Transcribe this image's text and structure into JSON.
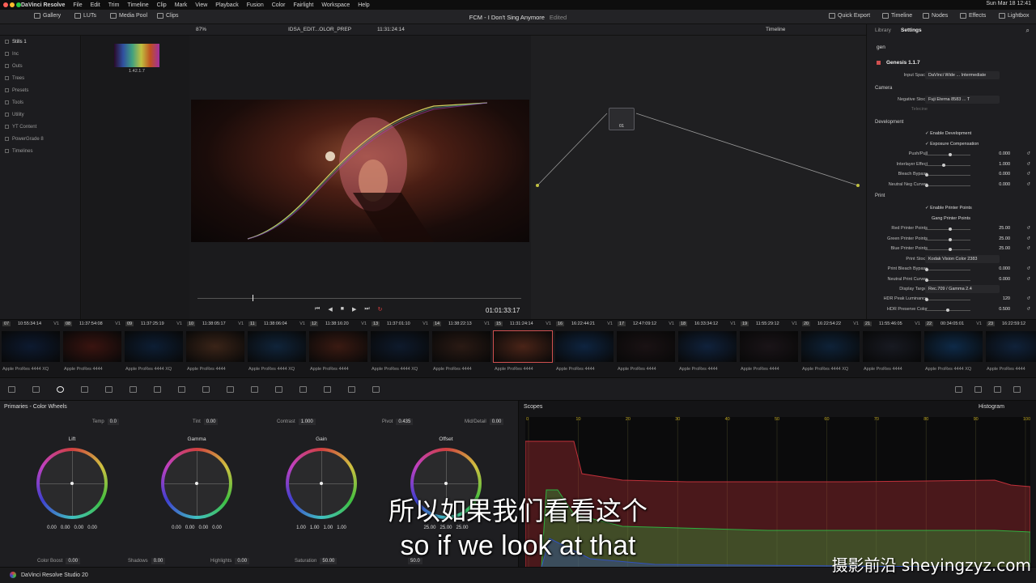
{
  "menubar": {
    "items": [
      "DaVinci Resolve",
      "File",
      "Edit",
      "Trim",
      "Timeline",
      "Clip",
      "Mark",
      "View",
      "Playback",
      "Fusion",
      "Color",
      "Fairlight",
      "Workspace",
      "Help"
    ],
    "clock": "Sun Mar 18 12:41"
  },
  "toolbar": {
    "gallery": "Gallery",
    "luts": "LUTs",
    "media_pool": "Media Pool",
    "clips": "Clips",
    "project_title": "FCM - I Don't Sing Anymore",
    "edited": "Edited",
    "quick_export": "Quick Export",
    "timeline": "Timeline",
    "nodes": "Nodes",
    "effects": "Effects",
    "lightbox": "Lightbox"
  },
  "subbar": {
    "zoom": "87%",
    "clip_name": "IDSA_EDIT...OLOR_PREP",
    "timecode": "11:31:24:14",
    "timeline_label": "Timeline",
    "library_tab": "Library",
    "settings_tab": "Settings"
  },
  "gallery": {
    "items": [
      "Stills 1",
      "Inc",
      "Outs",
      "Trees",
      "Presets",
      "Tools",
      "Utility",
      "YT Content",
      "PowerGrade 8",
      "Timelines"
    ],
    "still_label": "1.42.1.7"
  },
  "viewer": {
    "timecode": "01:01:33:17"
  },
  "nodes": {
    "node_label": "01"
  },
  "settings": {
    "search": "gen",
    "plugin": "Genesis 1.1.7",
    "input_space_label": "Input Space",
    "input_space": "DaVinci Wide ... Intermediate",
    "camera_header": "Camera",
    "negative_stock_label": "Negative Stock",
    "negative_stock": "Fuji Eterna 8583 ... T",
    "telecine_label": "Telecine",
    "development_header": "Development",
    "enable_development": "Enable Development",
    "exposure_compensation": "Exposure Compensation",
    "rows_dev": [
      {
        "label": "Push/Pull",
        "value": "0.000",
        "pos": 0.55
      },
      {
        "label": "Interlayer Effect",
        "value": "1.000",
        "pos": 0.4
      },
      {
        "label": "Bleach Bypass",
        "value": "0.000",
        "pos": 0.0
      },
      {
        "label": "Neutral Neg Curves",
        "value": "0.000",
        "pos": 0.0
      }
    ],
    "print_header": "Print",
    "enable_printer_points": "Enable Printer Points",
    "gang_printer_points": "Gang Printer Points",
    "rows_print": [
      {
        "label": "Red Printer Points",
        "value": "25.00",
        "pos": 0.55
      },
      {
        "label": "Green Printer Points",
        "value": "25.00",
        "pos": 0.55
      },
      {
        "label": "Blue Printer Points",
        "value": "25.00",
        "pos": 0.55
      }
    ],
    "print_stock_label": "Print Stock",
    "print_stock": "Kodak Vision Color 2383",
    "rows_print2": [
      {
        "label": "Print Bleach Bypass",
        "value": "0.000",
        "pos": 0.0
      },
      {
        "label": "Neutral Print Curves",
        "value": "0.000",
        "pos": 0.0
      }
    ],
    "display_target_label": "Display Target",
    "display_target": "Rec.709 / Gamma 2.4",
    "rows_print3": [
      {
        "label": "HDR Peak Luminance",
        "value": "120",
        "pos": 0.0
      },
      {
        "label": "HDR Preserve Color",
        "value": "0.500",
        "pos": 0.5
      }
    ]
  },
  "clips": [
    {
      "num": "07",
      "tc": "10:55:34:14",
      "track": "V1",
      "codec": "Apple ProRes 4444 XQ",
      "color": "#0d1a30"
    },
    {
      "num": "08",
      "tc": "11:37:54:08",
      "track": "V1",
      "codec": "Apple ProRes 4444",
      "color": "#3a1410"
    },
    {
      "num": "09",
      "tc": "11:37:25:19",
      "track": "V1",
      "codec": "Apple ProRes 4444 XQ",
      "color": "#0d1e34"
    },
    {
      "num": "10",
      "tc": "11:38:05:17",
      "track": "V1",
      "codec": "Apple ProRes 4444",
      "color": "#3a2418"
    },
    {
      "num": "11",
      "tc": "11:38:06:04",
      "track": "V1",
      "codec": "Apple ProRes 4444 XQ",
      "color": "#10243a"
    },
    {
      "num": "12",
      "tc": "11:38:16:20",
      "track": "V1",
      "codec": "Apple ProRes 4444",
      "color": "#3a1a12"
    },
    {
      "num": "13",
      "tc": "11:37:01:10",
      "track": "V1",
      "codec": "Apple ProRes 4444 XQ",
      "color": "#0e1a2c"
    },
    {
      "num": "14",
      "tc": "11:38:22:13",
      "track": "V1",
      "codec": "Apple ProRes 4444",
      "color": "#2a1a14"
    },
    {
      "num": "15",
      "tc": "11:31:24:14",
      "track": "V1",
      "codec": "Apple ProRes 4444",
      "color": "#4a2418",
      "selected": true
    },
    {
      "num": "16",
      "tc": "16:22:44:21",
      "track": "V1",
      "codec": "Apple ProRes 4444",
      "color": "#0e2440"
    },
    {
      "num": "17",
      "tc": "12:47:09:12",
      "track": "V1",
      "codec": "Apple ProRes 4444",
      "color": "#1a1214"
    },
    {
      "num": "18",
      "tc": "16:33:34:12",
      "track": "V1",
      "codec": "Apple ProRes 4444",
      "color": "#10223c"
    },
    {
      "num": "19",
      "tc": "11:55:29:12",
      "track": "V1",
      "codec": "Apple ProRes 4444",
      "color": "#1a1418"
    },
    {
      "num": "20",
      "tc": "16:22:54:22",
      "track": "V1",
      "codec": "Apple ProRes 4444 XQ",
      "color": "#0e2238"
    },
    {
      "num": "21",
      "tc": "11:55:46:05",
      "track": "V1",
      "codec": "Apple ProRes 4444",
      "color": "#181a22"
    },
    {
      "num": "22",
      "tc": "00:34:05:01",
      "track": "V1",
      "codec": "Apple ProRes 4444 XQ",
      "color": "#0e2a48"
    },
    {
      "num": "23",
      "tc": "16:22:59:12",
      "track": "V1",
      "codec": "Apple ProRes 4444",
      "color": "#10223a"
    }
  ],
  "wheels": {
    "title": "Primaries - Color Wheels",
    "temp_label": "Temp",
    "temp": "0.0",
    "tint_label": "Tint",
    "tint": "0.00",
    "contrast_label": "Contrast",
    "contrast": "1.000",
    "pivot_label": "Pivot",
    "pivot": "0.435",
    "middetail_label": "Mid/Detail",
    "middetail": "0.00",
    "items": [
      {
        "name": "Lift",
        "values": [
          "0.00",
          "0.00",
          "0.00",
          "0.00"
        ]
      },
      {
        "name": "Gamma",
        "values": [
          "0.00",
          "0.00",
          "0.00",
          "0.00"
        ]
      },
      {
        "name": "Gain",
        "values": [
          "1.00",
          "1.00",
          "1.00",
          "1.00"
        ]
      },
      {
        "name": "Offset",
        "values": [
          "25.00",
          "25.00",
          "25.00"
        ]
      }
    ],
    "colorboost_label": "Color Boost",
    "colorboost": "0.00",
    "shadows_label": "Shadows",
    "shadows": "0.00",
    "highlights_label": "Highlights",
    "highlights": "0.00",
    "saturation_label": "Saturation",
    "saturation": "50.00",
    "hue_value": "50.0"
  },
  "scopes": {
    "title": "Scopes",
    "mode": "Histogram",
    "x_ticks": [
      "0",
      "10",
      "20",
      "30",
      "40",
      "50",
      "60",
      "70",
      "80",
      "90",
      "100"
    ]
  },
  "statusbar": {
    "app": "DaVinci Resolve Studio 20"
  },
  "subtitle": {
    "zh": "所以如果我们看看这个",
    "en": "so if we look at that"
  },
  "watermark": "摄影前沿 sheyingzyz.com",
  "colors": {
    "accent": "#d05050",
    "histo_red": "#c0303a",
    "histo_green": "#30b040",
    "histo_blue": "#3050c0"
  }
}
